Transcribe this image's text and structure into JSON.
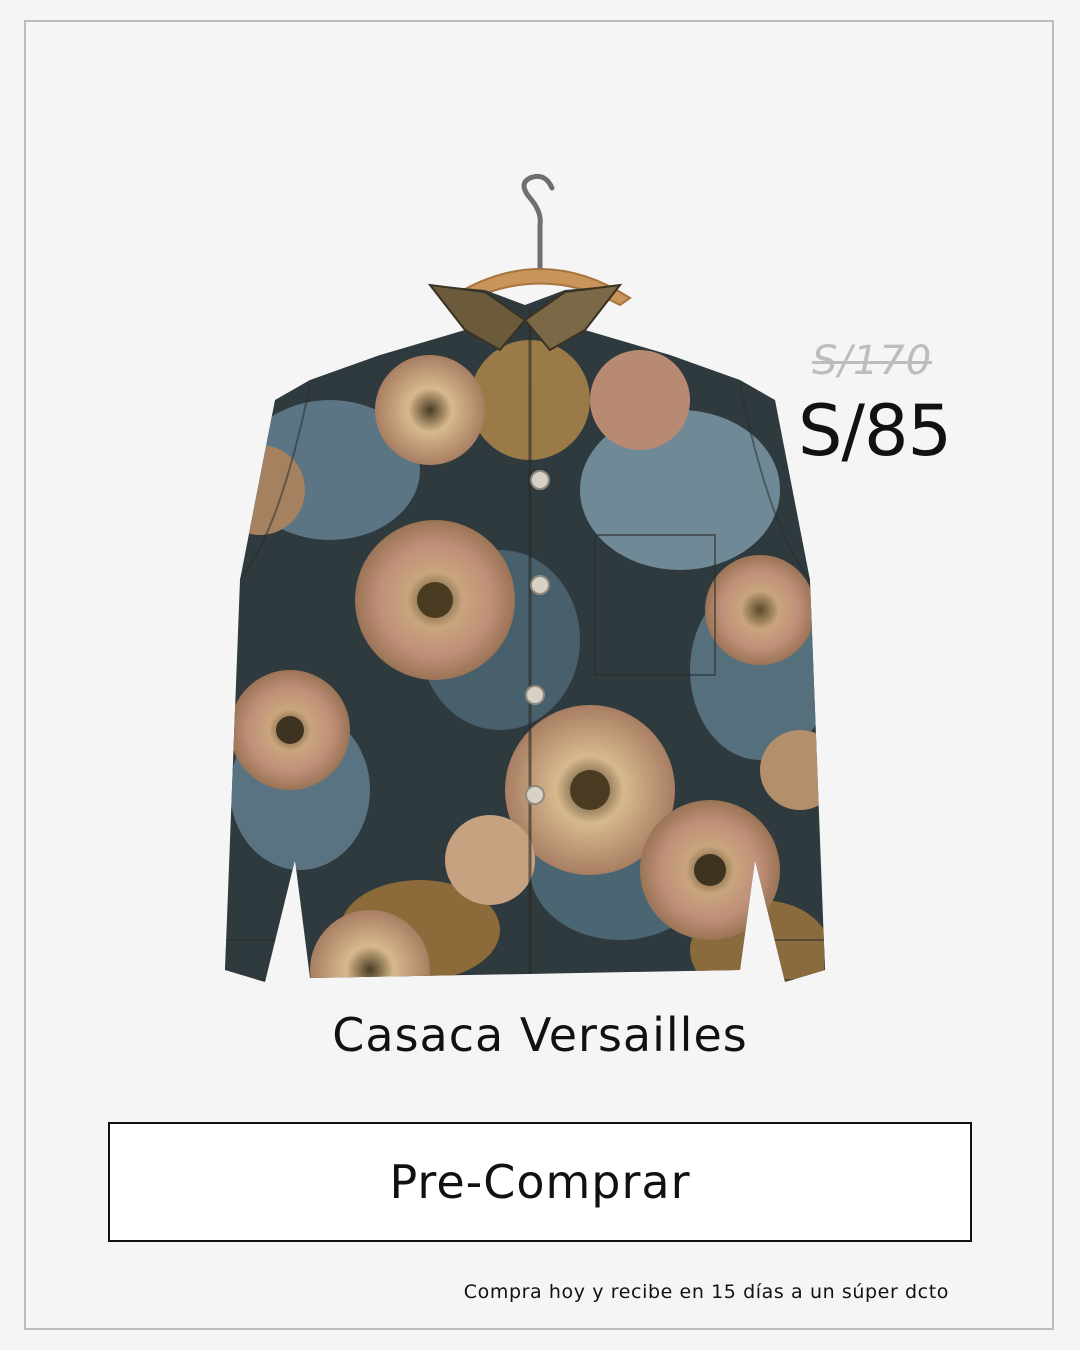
{
  "product": {
    "name": "Casaca Versailles",
    "price_original": "S/170",
    "price_current": "S/85",
    "image_icon": "floral-jacket-on-hanger-illustration"
  },
  "cta": {
    "label": "Pre-Comprar"
  },
  "footnote": "Compra hoy y recibe en 15 días a un súper dcto",
  "colors": {
    "background": "#f5f5f5",
    "frame_border": "#bcbcbc",
    "text": "#111111",
    "old_price": "#bdbdbd",
    "button_bg": "#ffffff"
  }
}
